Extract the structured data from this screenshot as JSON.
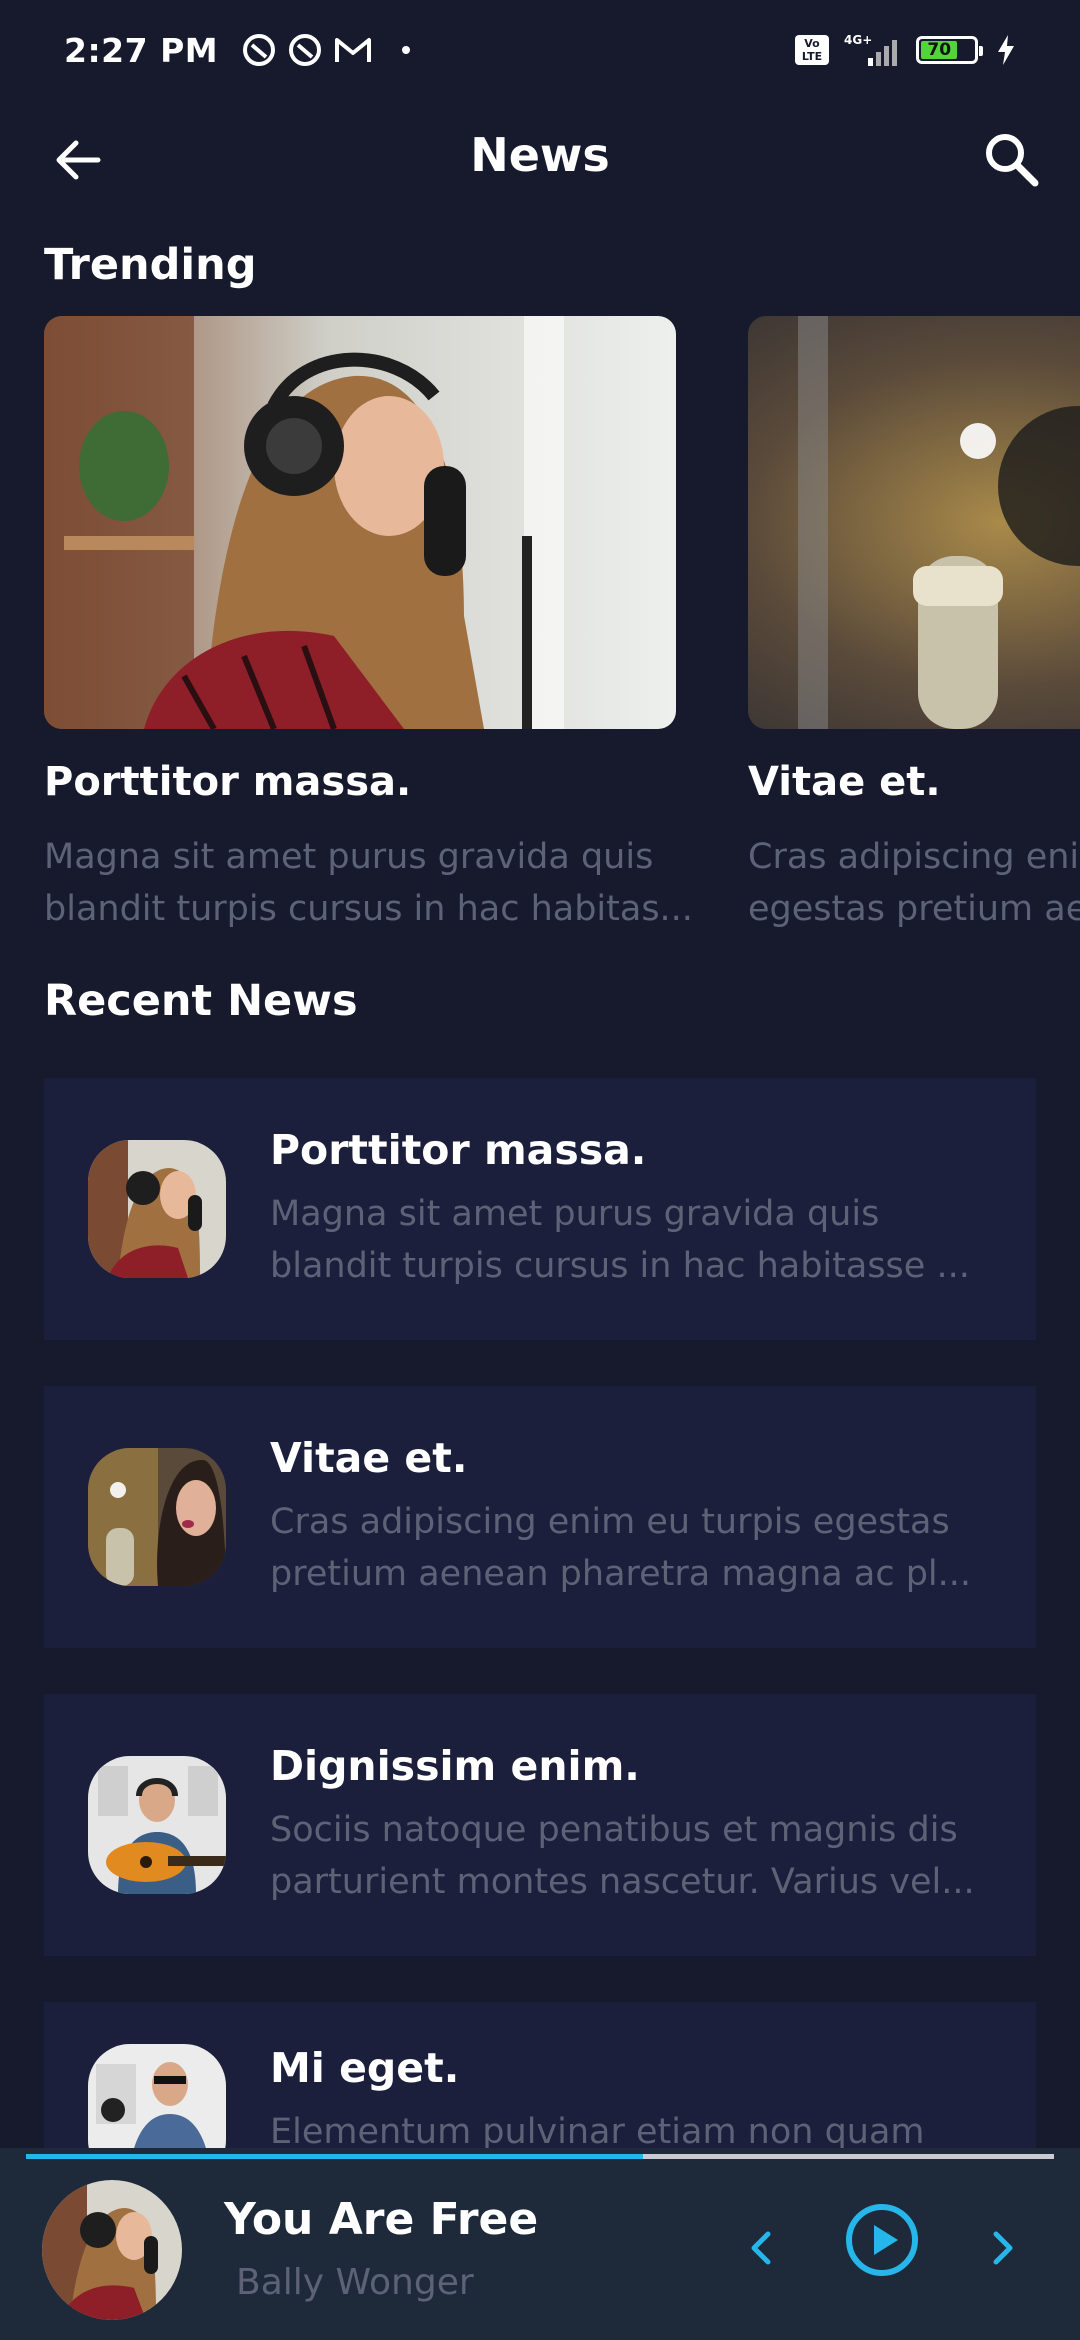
{
  "status_bar": {
    "time": "2:27 PM",
    "network": "4G+",
    "volte": "Vo LTE",
    "battery": "70"
  },
  "header": {
    "title": "News"
  },
  "trending": {
    "section_title": "Trending",
    "items": [
      {
        "title": "Porttitor massa.",
        "desc_line1": "Magna sit amet purus gravida quis",
        "desc_line2": "blandit turpis cursus in hac habitas..."
      },
      {
        "title": "Vitae et.",
        "desc_line1": "Cras adipiscing enim",
        "desc_line2": "egestas pretium ae"
      }
    ]
  },
  "recent": {
    "section_title": "Recent News",
    "items": [
      {
        "title": "Porttitor massa.",
        "desc_line1": "Magna sit amet purus gravida quis",
        "desc_line2": "blandit turpis cursus in hac habitasse ..."
      },
      {
        "title": "Vitae et.",
        "desc_line1": "Cras adipiscing enim eu turpis egestas",
        "desc_line2": "pretium aenean pharetra magna ac pl..."
      },
      {
        "title": "Dignissim enim.",
        "desc_line1": "Sociis natoque penatibus et magnis dis",
        "desc_line2": "parturient montes nascetur. Varius vel..."
      },
      {
        "title": "Mi eget.",
        "desc_line1": "Elementum pulvinar etiam non quam",
        "desc_line2": ""
      }
    ]
  },
  "player": {
    "title": "You Are Free",
    "artist": "Bally Wonger",
    "progress": 0.6
  },
  "colors": {
    "background": "#161a2c",
    "card": "#1b1f3b",
    "accent": "#27b6ea",
    "muted_text": "#5d6277",
    "player_bg": "#1e2a3a"
  },
  "icons": {
    "back": "arrow-left-icon",
    "search": "search-icon",
    "prev": "chevron-left-icon",
    "play": "play-circle-icon",
    "next": "chevron-right-icon"
  }
}
